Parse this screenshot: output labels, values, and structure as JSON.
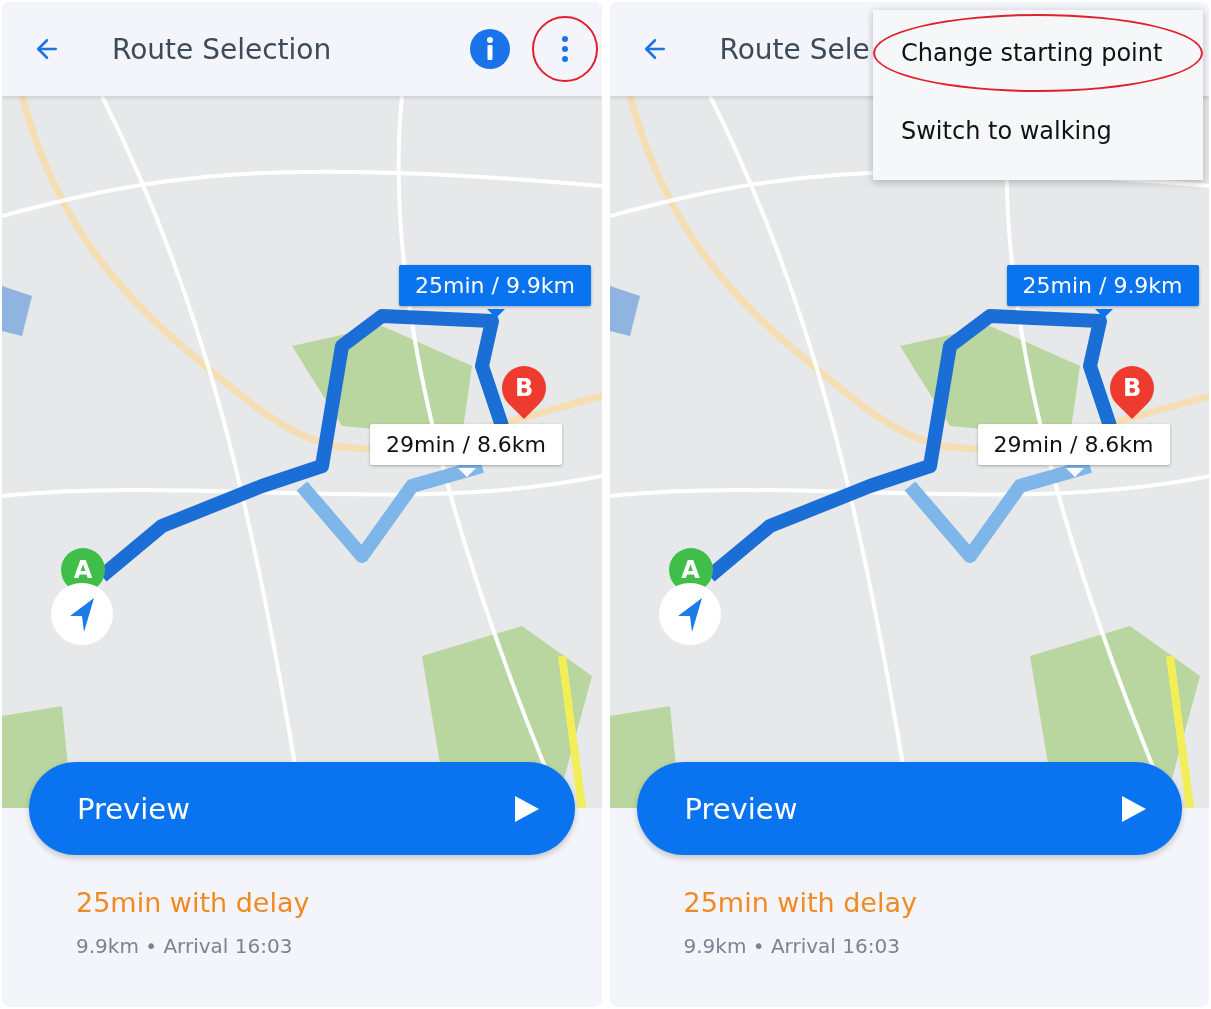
{
  "panels": [
    {
      "header": {
        "title": "Route Selection",
        "actions": [
          {
            "kind": "info"
          },
          {
            "kind": "more",
            "circled": true
          }
        ]
      },
      "callouts": [
        {
          "text": "25min / 9.9km",
          "selected": true
        },
        {
          "text": "29min / 8.6km",
          "selected": false
        }
      ],
      "markers": [
        {
          "kind": "destination",
          "label": "B"
        },
        {
          "kind": "start",
          "label": "A"
        }
      ],
      "preview_button": {
        "label": "Preview"
      },
      "summary": {
        "delay": "25min with delay",
        "details": "9.9km • Arrival 16:03"
      }
    },
    {
      "header": {
        "title": "Route Sele"
      },
      "menu": {
        "items": [
          {
            "label": "Change starting point",
            "circled": true
          },
          {
            "label": "Switch to walking",
            "circled": false
          }
        ]
      },
      "callouts": [
        {
          "text": "25min / 9.9km",
          "selected": true
        },
        {
          "text": "29min / 8.6km",
          "selected": false
        }
      ],
      "markers": [
        {
          "kind": "destination",
          "label": "B"
        },
        {
          "kind": "start",
          "label": "A"
        }
      ],
      "preview_button": {
        "label": "Preview"
      },
      "summary": {
        "delay": "25min with delay",
        "details": "9.9km • Arrival 16:03"
      }
    }
  ]
}
